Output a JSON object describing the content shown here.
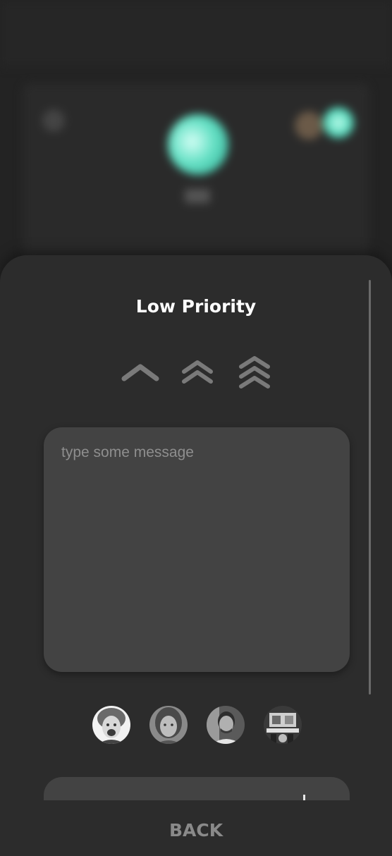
{
  "background": {
    "accent_color": "#64e0c4"
  },
  "sheet": {
    "title": "Low Priority",
    "priority_options": [
      {
        "name": "low",
        "icon": "chevron-up-icon"
      },
      {
        "name": "medium",
        "icon": "double-chevron-up-icon"
      },
      {
        "name": "high",
        "icon": "triple-chevron-up-icon"
      }
    ],
    "message": {
      "value": "",
      "placeholder": "type some message"
    },
    "recipients": [
      {
        "icon": "avatar-1"
      },
      {
        "icon": "avatar-2"
      },
      {
        "icon": "avatar-3"
      },
      {
        "icon": "avatar-4"
      }
    ]
  },
  "footer": {
    "back_label": "BACK"
  },
  "colors": {
    "sheet_bg": "#2c2c2c",
    "field_bg": "#434343",
    "icon_gray": "#7a7a7a",
    "title": "#ffffff",
    "back": "#8a8a8a"
  }
}
